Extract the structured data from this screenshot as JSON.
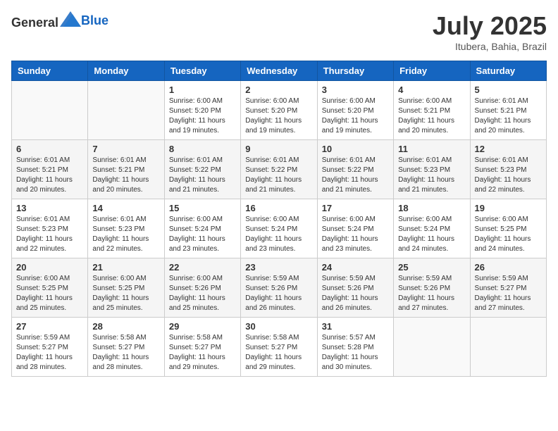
{
  "header": {
    "logo_general": "General",
    "logo_blue": "Blue",
    "month_year": "July 2025",
    "location": "Itubera, Bahia, Brazil"
  },
  "weekdays": [
    "Sunday",
    "Monday",
    "Tuesday",
    "Wednesday",
    "Thursday",
    "Friday",
    "Saturday"
  ],
  "weeks": [
    [
      {
        "day": "",
        "sunrise": "",
        "sunset": "",
        "daylight": "",
        "empty": true
      },
      {
        "day": "",
        "sunrise": "",
        "sunset": "",
        "daylight": "",
        "empty": true
      },
      {
        "day": "1",
        "sunrise": "Sunrise: 6:00 AM",
        "sunset": "Sunset: 5:20 PM",
        "daylight": "Daylight: 11 hours and 19 minutes.",
        "empty": false
      },
      {
        "day": "2",
        "sunrise": "Sunrise: 6:00 AM",
        "sunset": "Sunset: 5:20 PM",
        "daylight": "Daylight: 11 hours and 19 minutes.",
        "empty": false
      },
      {
        "day": "3",
        "sunrise": "Sunrise: 6:00 AM",
        "sunset": "Sunset: 5:20 PM",
        "daylight": "Daylight: 11 hours and 19 minutes.",
        "empty": false
      },
      {
        "day": "4",
        "sunrise": "Sunrise: 6:00 AM",
        "sunset": "Sunset: 5:21 PM",
        "daylight": "Daylight: 11 hours and 20 minutes.",
        "empty": false
      },
      {
        "day": "5",
        "sunrise": "Sunrise: 6:01 AM",
        "sunset": "Sunset: 5:21 PM",
        "daylight": "Daylight: 11 hours and 20 minutes.",
        "empty": false
      }
    ],
    [
      {
        "day": "6",
        "sunrise": "Sunrise: 6:01 AM",
        "sunset": "Sunset: 5:21 PM",
        "daylight": "Daylight: 11 hours and 20 minutes.",
        "empty": false
      },
      {
        "day": "7",
        "sunrise": "Sunrise: 6:01 AM",
        "sunset": "Sunset: 5:21 PM",
        "daylight": "Daylight: 11 hours and 20 minutes.",
        "empty": false
      },
      {
        "day": "8",
        "sunrise": "Sunrise: 6:01 AM",
        "sunset": "Sunset: 5:22 PM",
        "daylight": "Daylight: 11 hours and 21 minutes.",
        "empty": false
      },
      {
        "day": "9",
        "sunrise": "Sunrise: 6:01 AM",
        "sunset": "Sunset: 5:22 PM",
        "daylight": "Daylight: 11 hours and 21 minutes.",
        "empty": false
      },
      {
        "day": "10",
        "sunrise": "Sunrise: 6:01 AM",
        "sunset": "Sunset: 5:22 PM",
        "daylight": "Daylight: 11 hours and 21 minutes.",
        "empty": false
      },
      {
        "day": "11",
        "sunrise": "Sunrise: 6:01 AM",
        "sunset": "Sunset: 5:23 PM",
        "daylight": "Daylight: 11 hours and 21 minutes.",
        "empty": false
      },
      {
        "day": "12",
        "sunrise": "Sunrise: 6:01 AM",
        "sunset": "Sunset: 5:23 PM",
        "daylight": "Daylight: 11 hours and 22 minutes.",
        "empty": false
      }
    ],
    [
      {
        "day": "13",
        "sunrise": "Sunrise: 6:01 AM",
        "sunset": "Sunset: 5:23 PM",
        "daylight": "Daylight: 11 hours and 22 minutes.",
        "empty": false
      },
      {
        "day": "14",
        "sunrise": "Sunrise: 6:01 AM",
        "sunset": "Sunset: 5:23 PM",
        "daylight": "Daylight: 11 hours and 22 minutes.",
        "empty": false
      },
      {
        "day": "15",
        "sunrise": "Sunrise: 6:00 AM",
        "sunset": "Sunset: 5:24 PM",
        "daylight": "Daylight: 11 hours and 23 minutes.",
        "empty": false
      },
      {
        "day": "16",
        "sunrise": "Sunrise: 6:00 AM",
        "sunset": "Sunset: 5:24 PM",
        "daylight": "Daylight: 11 hours and 23 minutes.",
        "empty": false
      },
      {
        "day": "17",
        "sunrise": "Sunrise: 6:00 AM",
        "sunset": "Sunset: 5:24 PM",
        "daylight": "Daylight: 11 hours and 23 minutes.",
        "empty": false
      },
      {
        "day": "18",
        "sunrise": "Sunrise: 6:00 AM",
        "sunset": "Sunset: 5:24 PM",
        "daylight": "Daylight: 11 hours and 24 minutes.",
        "empty": false
      },
      {
        "day": "19",
        "sunrise": "Sunrise: 6:00 AM",
        "sunset": "Sunset: 5:25 PM",
        "daylight": "Daylight: 11 hours and 24 minutes.",
        "empty": false
      }
    ],
    [
      {
        "day": "20",
        "sunrise": "Sunrise: 6:00 AM",
        "sunset": "Sunset: 5:25 PM",
        "daylight": "Daylight: 11 hours and 25 minutes.",
        "empty": false
      },
      {
        "day": "21",
        "sunrise": "Sunrise: 6:00 AM",
        "sunset": "Sunset: 5:25 PM",
        "daylight": "Daylight: 11 hours and 25 minutes.",
        "empty": false
      },
      {
        "day": "22",
        "sunrise": "Sunrise: 6:00 AM",
        "sunset": "Sunset: 5:26 PM",
        "daylight": "Daylight: 11 hours and 25 minutes.",
        "empty": false
      },
      {
        "day": "23",
        "sunrise": "Sunrise: 5:59 AM",
        "sunset": "Sunset: 5:26 PM",
        "daylight": "Daylight: 11 hours and 26 minutes.",
        "empty": false
      },
      {
        "day": "24",
        "sunrise": "Sunrise: 5:59 AM",
        "sunset": "Sunset: 5:26 PM",
        "daylight": "Daylight: 11 hours and 26 minutes.",
        "empty": false
      },
      {
        "day": "25",
        "sunrise": "Sunrise: 5:59 AM",
        "sunset": "Sunset: 5:26 PM",
        "daylight": "Daylight: 11 hours and 27 minutes.",
        "empty": false
      },
      {
        "day": "26",
        "sunrise": "Sunrise: 5:59 AM",
        "sunset": "Sunset: 5:27 PM",
        "daylight": "Daylight: 11 hours and 27 minutes.",
        "empty": false
      }
    ],
    [
      {
        "day": "27",
        "sunrise": "Sunrise: 5:59 AM",
        "sunset": "Sunset: 5:27 PM",
        "daylight": "Daylight: 11 hours and 28 minutes.",
        "empty": false
      },
      {
        "day": "28",
        "sunrise": "Sunrise: 5:58 AM",
        "sunset": "Sunset: 5:27 PM",
        "daylight": "Daylight: 11 hours and 28 minutes.",
        "empty": false
      },
      {
        "day": "29",
        "sunrise": "Sunrise: 5:58 AM",
        "sunset": "Sunset: 5:27 PM",
        "daylight": "Daylight: 11 hours and 29 minutes.",
        "empty": false
      },
      {
        "day": "30",
        "sunrise": "Sunrise: 5:58 AM",
        "sunset": "Sunset: 5:27 PM",
        "daylight": "Daylight: 11 hours and 29 minutes.",
        "empty": false
      },
      {
        "day": "31",
        "sunrise": "Sunrise: 5:57 AM",
        "sunset": "Sunset: 5:28 PM",
        "daylight": "Daylight: 11 hours and 30 minutes.",
        "empty": false
      },
      {
        "day": "",
        "sunrise": "",
        "sunset": "",
        "daylight": "",
        "empty": true
      },
      {
        "day": "",
        "sunrise": "",
        "sunset": "",
        "daylight": "",
        "empty": true
      }
    ]
  ]
}
